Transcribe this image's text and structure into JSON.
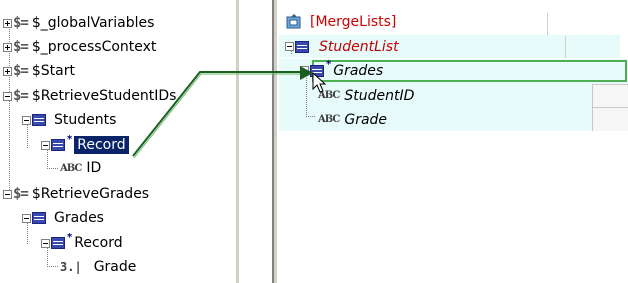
{
  "left_tree": {
    "nodes": [
      {
        "label": "$_globalVariables"
      },
      {
        "label": "$_processContext"
      },
      {
        "label": "$Start"
      },
      {
        "label": "$RetrieveStudentIDs"
      },
      {
        "label": "Students"
      },
      {
        "label": "Record"
      },
      {
        "label": "ID"
      },
      {
        "label": "$RetrieveGrades"
      },
      {
        "label": "Grades"
      },
      {
        "label": "Record"
      },
      {
        "label": "Grade"
      }
    ]
  },
  "right_tree": {
    "nodes": [
      {
        "label": "[MergeLists]"
      },
      {
        "label": "StudentList"
      },
      {
        "label": "Grades"
      },
      {
        "label": "StudentID"
      },
      {
        "label": "Grade"
      }
    ]
  },
  "icons": {
    "process": "dollar-sign-icon",
    "record": "record-icon",
    "text_field": "abc-icon",
    "numeric_field": "number-icon",
    "root": "merge-process-icon"
  },
  "colors": {
    "selection": "#0a246a",
    "mapping_line": "#1b5e20",
    "highlight_row": "#e8fbfb",
    "root_label": "#d00000",
    "student_list_label": "#c00000"
  }
}
